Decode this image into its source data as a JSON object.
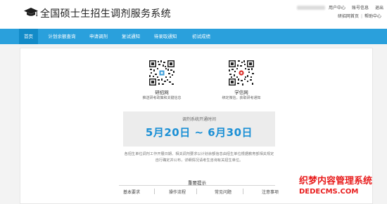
{
  "header": {
    "title": "全国硕士生招生调剂服务系统",
    "logo_icon": "graduation-cap-icon",
    "user_links": [
      "用户中心",
      "账号信息",
      "退出"
    ],
    "site_links": [
      "研招网首页",
      "帮助中心"
    ]
  },
  "nav": {
    "items": [
      {
        "label": "首页",
        "active": true
      },
      {
        "label": "计划余额查询",
        "active": false
      },
      {
        "label": "申请调剂",
        "active": false
      },
      {
        "label": "复试通知",
        "active": false
      },
      {
        "label": "待录取通知",
        "active": false
      },
      {
        "label": "初试成绩",
        "active": false
      }
    ],
    "bar_color": "#2aa0dc",
    "active_color": "#138bc8"
  },
  "qrcodes": [
    {
      "title": "研招网",
      "desc": "推送研考政策和关键信息",
      "logo_color": "#3b9cd8"
    },
    {
      "title": "学信网",
      "desc": "绑定微信，获取研考通知",
      "logo_color": "#d9312b"
    }
  ],
  "schedule": {
    "label": "调剂系统开通时间",
    "range": "5月20日 ~ 6月30日",
    "accent": "#1a8fd5"
  },
  "notice": "各招生单位调剂工作开展日期、相关调剂要求以计划余额信息由招生单位根据教育部相关规定自行确定并公布，详细情况请考生咨询有关招生单位。",
  "tips": {
    "title": "重要提示",
    "items": [
      "基本要求",
      "操作流程",
      "常见问题",
      "注意事项"
    ]
  },
  "watermark": {
    "cn": "织梦内容管理系统",
    "en": "DEDECMS.COM",
    "color": "#e81c1c"
  }
}
